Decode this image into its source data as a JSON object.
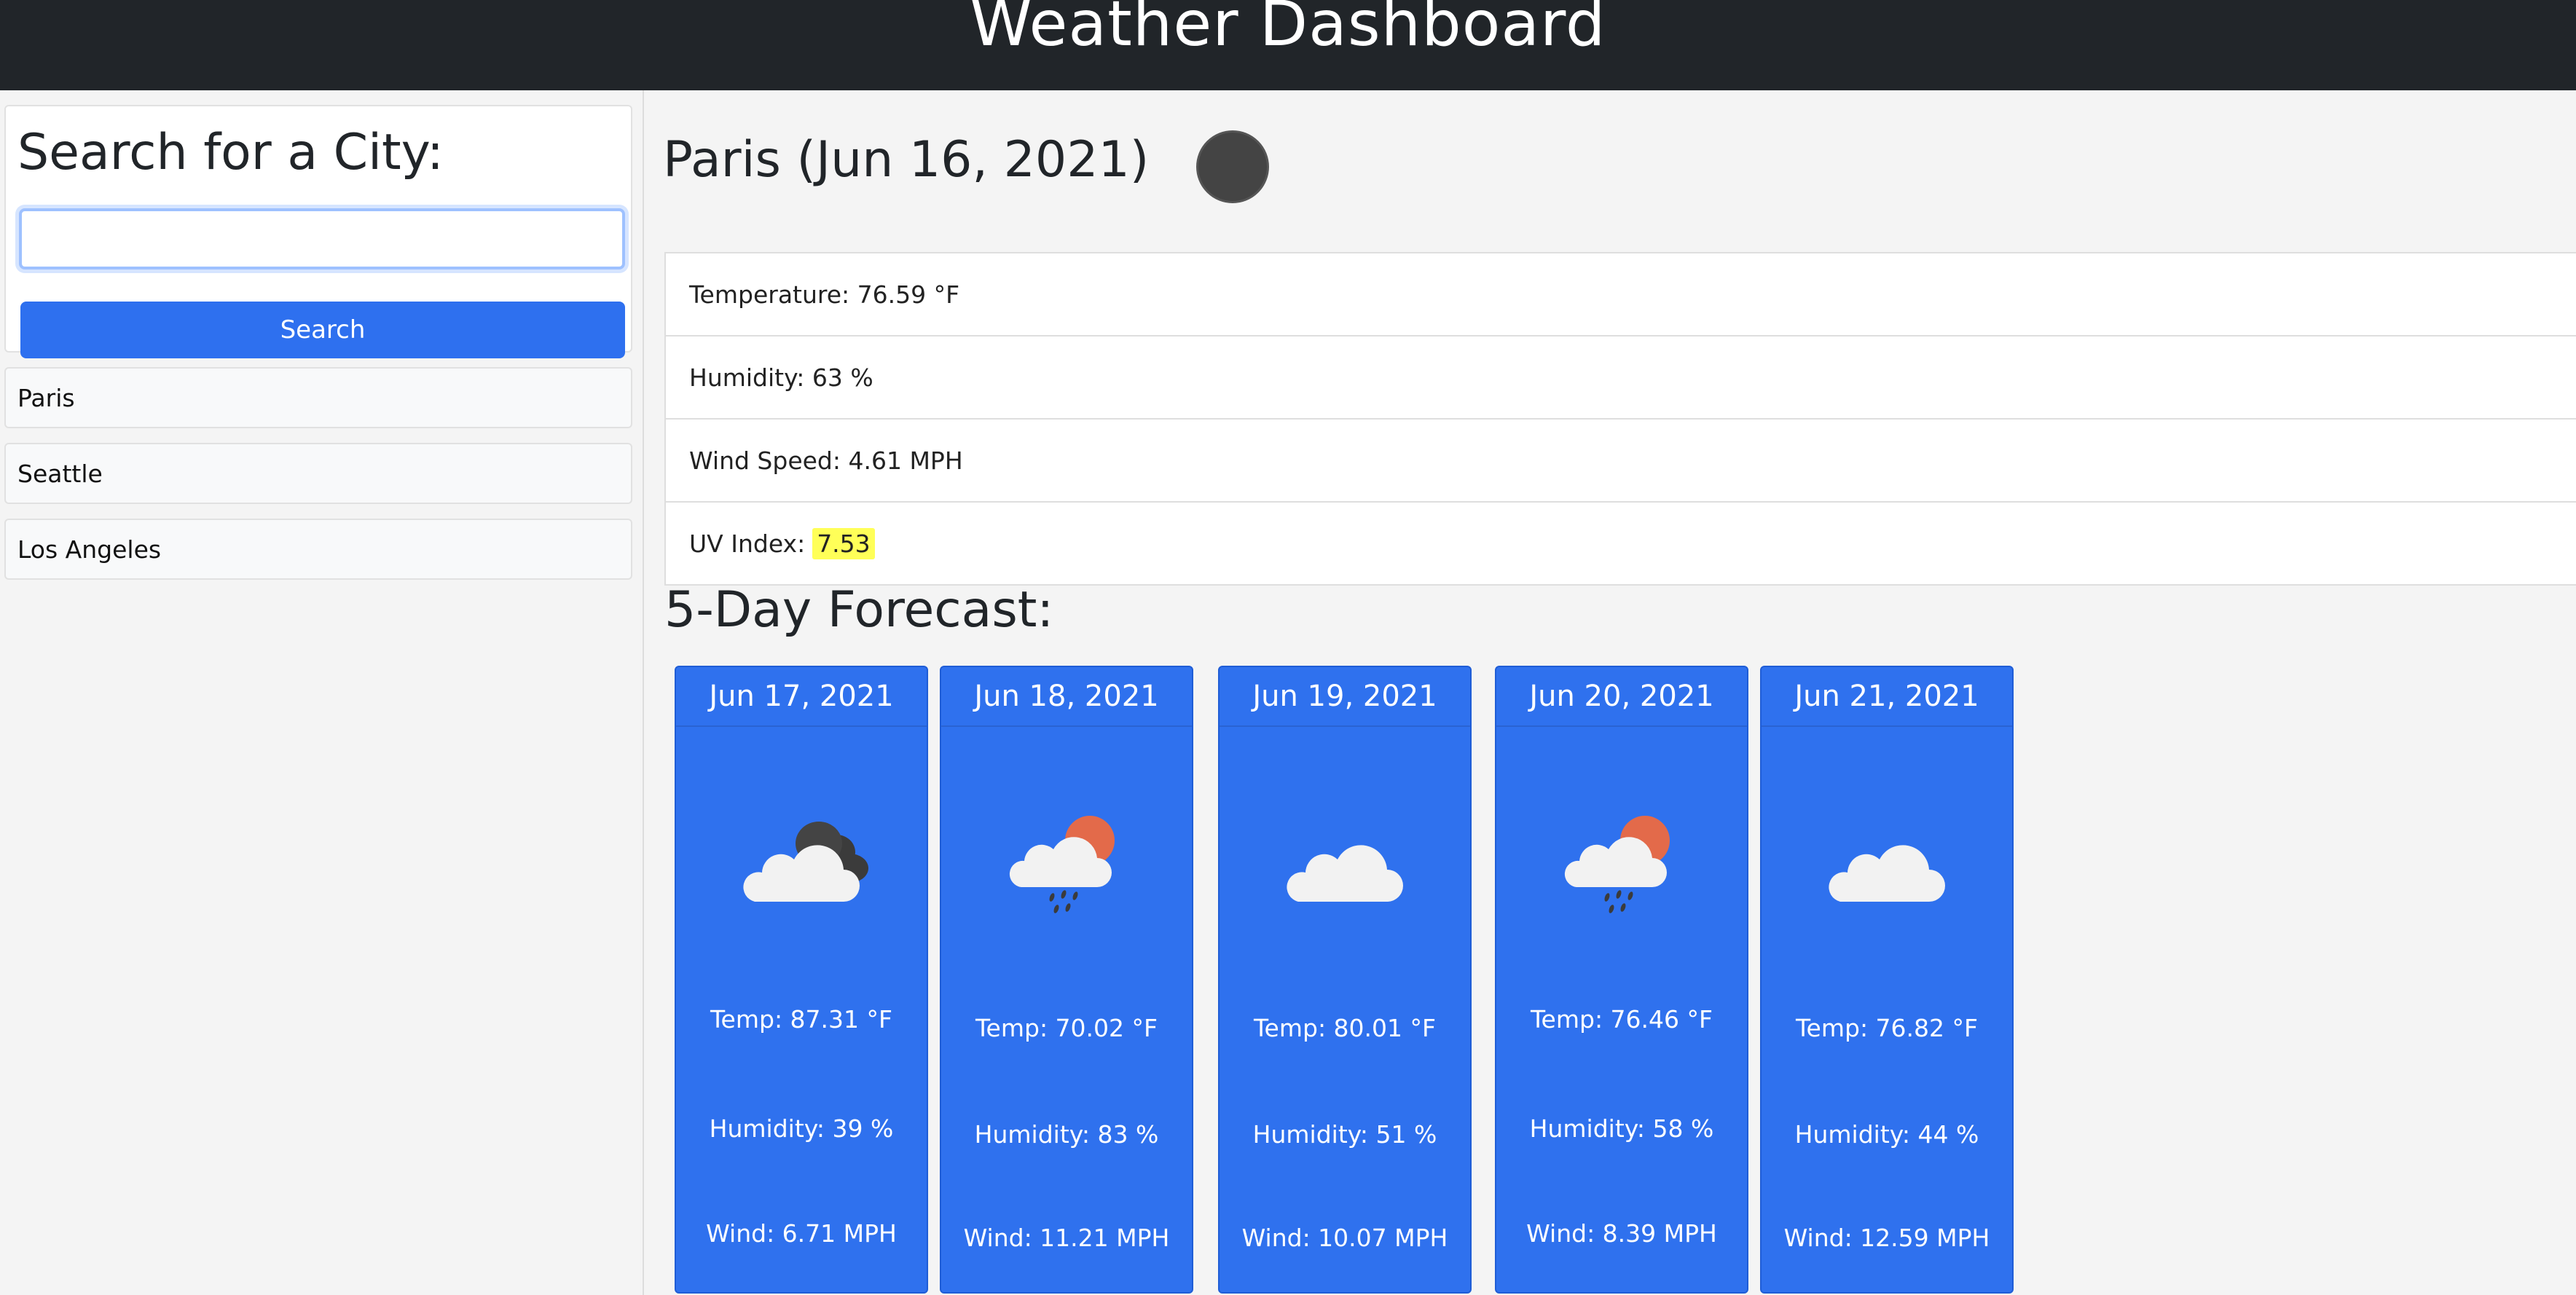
{
  "header": {
    "title": "Weather Dashboard"
  },
  "search": {
    "heading": "Search for a City:",
    "input_value": "",
    "placeholder": "",
    "button_label": "Search"
  },
  "history": [
    "Paris",
    "Seattle",
    "Los Angeles"
  ],
  "current": {
    "city_title": "Paris (Jun 16, 2021)",
    "temperature_label": "Temperature: 76.59 °F",
    "humidity_label": "Humidity: 63 %",
    "wind_label": "Wind Speed: 4.61 MPH",
    "uv_label": "UV Index:",
    "uv_value": "7.53",
    "uv_color": "#ffff58"
  },
  "forecast": {
    "heading": "5-Day Forecast:",
    "days": [
      {
        "date": "Jun 17, 2021",
        "icon": "broken-clouds-icon",
        "temp": "Temp: 87.31 °F",
        "humidity": "Humidity: 39 %",
        "wind": "Wind: 6.71 MPH"
      },
      {
        "date": "Jun 18, 2021",
        "icon": "rain-sun-icon",
        "temp": "Temp: 70.02 °F",
        "humidity": "Humidity: 83 %",
        "wind": "Wind: 11.21 MPH"
      },
      {
        "date": "Jun 19, 2021",
        "icon": "cloud-icon",
        "temp": "Temp: 80.01 °F",
        "humidity": "Humidity: 51 %",
        "wind": "Wind: 10.07 MPH"
      },
      {
        "date": "Jun 20, 2021",
        "icon": "rain-sun-icon",
        "temp": "Temp: 76.46 °F",
        "humidity": "Humidity: 58 %",
        "wind": "Wind: 8.39 MPH"
      },
      {
        "date": "Jun 21, 2021",
        "icon": "cloud-icon",
        "temp": "Temp: 76.82 °F",
        "humidity": "Humidity: 44 %",
        "wind": "Wind: 12.59 MPH"
      }
    ]
  },
  "colors": {
    "header_bg": "#212529",
    "accent": "#2f71ee",
    "uv_badge": "#ffff58"
  }
}
